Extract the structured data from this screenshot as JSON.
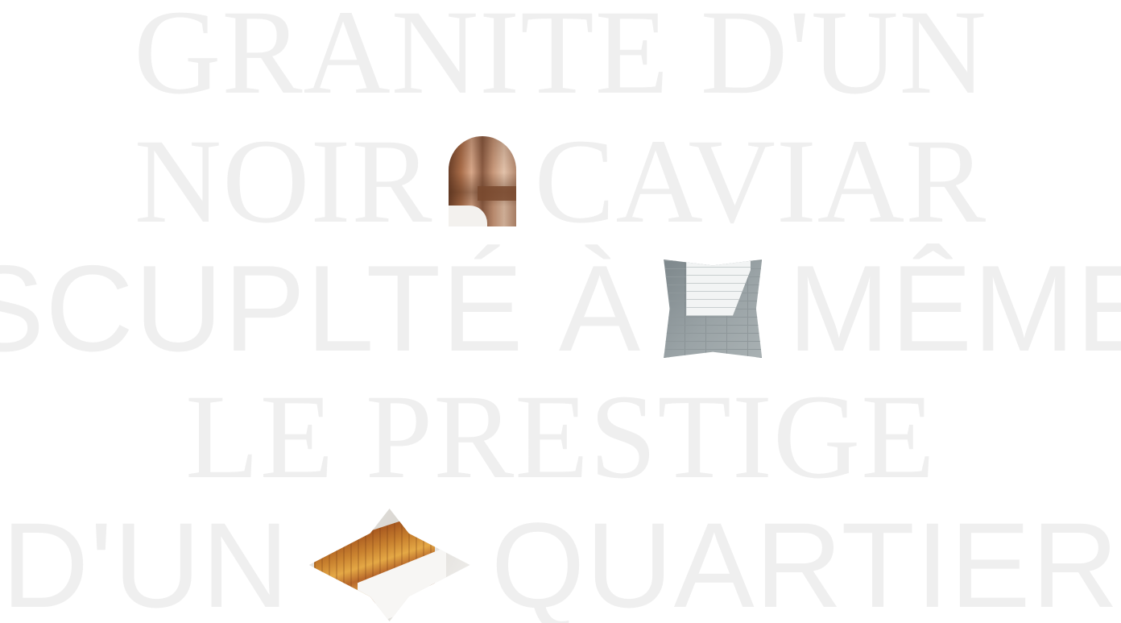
{
  "headline": {
    "line1": {
      "text": "GRANITE D'UN"
    },
    "line2": {
      "before": "NOIR",
      "after": "CAVIAR"
    },
    "line3": {
      "before": "SCUPLTÉ À",
      "after": "MÊME"
    },
    "line4": {
      "text": "LE PRESTIGE"
    },
    "line5": {
      "before": "D'UN",
      "after": "QUARTIER"
    }
  },
  "colors": {
    "headline_text": "#efefef",
    "background": "#ffffff"
  },
  "images": {
    "arch": "arch-portrait-image",
    "pinch": "pinched-brick-wall-image",
    "diamond": "diamond-wood-tray-image"
  }
}
